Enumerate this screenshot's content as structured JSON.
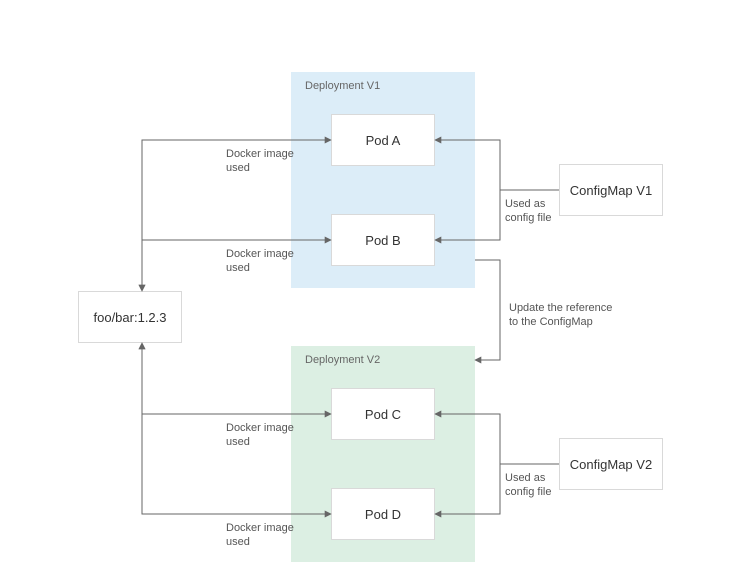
{
  "image": {
    "label": "foo/bar:1.2.3"
  },
  "deploy_v1": {
    "title": "Deployment V1",
    "podA": "Pod A",
    "podB": "Pod B"
  },
  "deploy_v2": {
    "title": "Deployment V2",
    "podC": "Pod C",
    "podD": "Pod D"
  },
  "configmap_v1": "ConfigMap V1",
  "configmap_v2": "ConfigMap V2",
  "edges": {
    "docker_image_used": "Docker image\nused",
    "used_as_config": "Used as\nconfig file",
    "update_reference": "Update the reference\nto the ConfigMap"
  }
}
